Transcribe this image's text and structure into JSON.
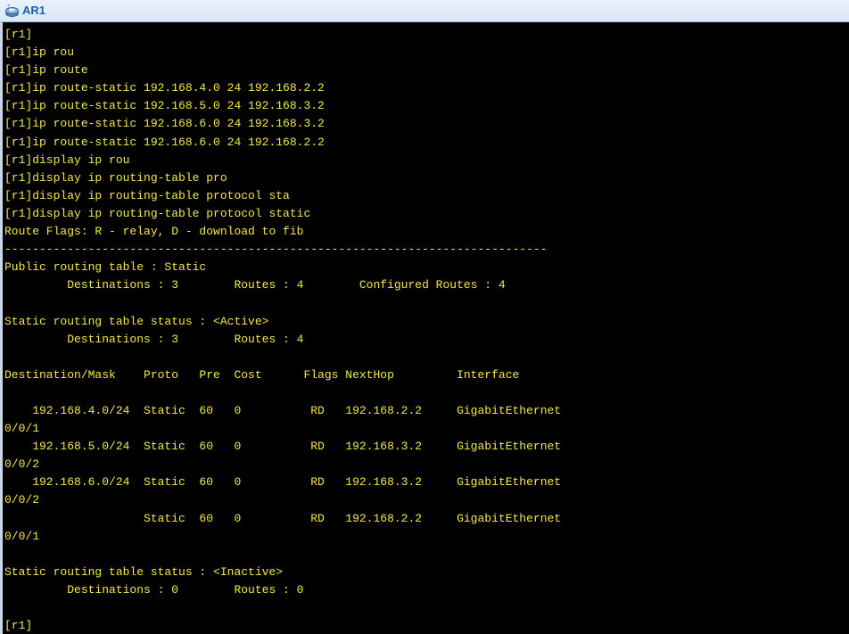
{
  "window": {
    "title": "AR1",
    "icon": "router-icon"
  },
  "terminal": {
    "colors": {
      "background": "#000000",
      "text": "#f2e84a"
    },
    "lines": [
      "[r1]",
      "[r1]ip rou",
      "[r1]ip route",
      "[r1]ip route-static 192.168.4.0 24 192.168.2.2",
      "[r1]ip route-static 192.168.5.0 24 192.168.3.2",
      "[r1]ip route-static 192.168.6.0 24 192.168.3.2",
      "[r1]ip route-static 192.168.6.0 24 192.168.2.2",
      "[r1]display ip rou",
      "[r1]display ip routing-table pro",
      "[r1]display ip routing-table protocol sta",
      "[r1]display ip routing-table protocol static",
      "Route Flags: R - relay, D - download to fib",
      "------------------------------------------------------------------------------",
      "Public routing table : Static",
      "         Destinations : 3        Routes : 4        Configured Routes : 4",
      "",
      "Static routing table status : <Active>",
      "         Destinations : 3        Routes : 4",
      "",
      "Destination/Mask    Proto   Pre  Cost      Flags NextHop         Interface",
      "",
      "    192.168.4.0/24  Static  60   0          RD   192.168.2.2     GigabitEthernet",
      "0/0/1",
      "    192.168.5.0/24  Static  60   0          RD   192.168.3.2     GigabitEthernet",
      "0/0/2",
      "    192.168.6.0/24  Static  60   0          RD   192.168.3.2     GigabitEthernet",
      "0/0/2",
      "                    Static  60   0          RD   192.168.2.2     GigabitEthernet",
      "0/0/1",
      "",
      "Static routing table status : <Inactive>",
      "         Destinations : 0        Routes : 0",
      "",
      "[r1]"
    ]
  }
}
